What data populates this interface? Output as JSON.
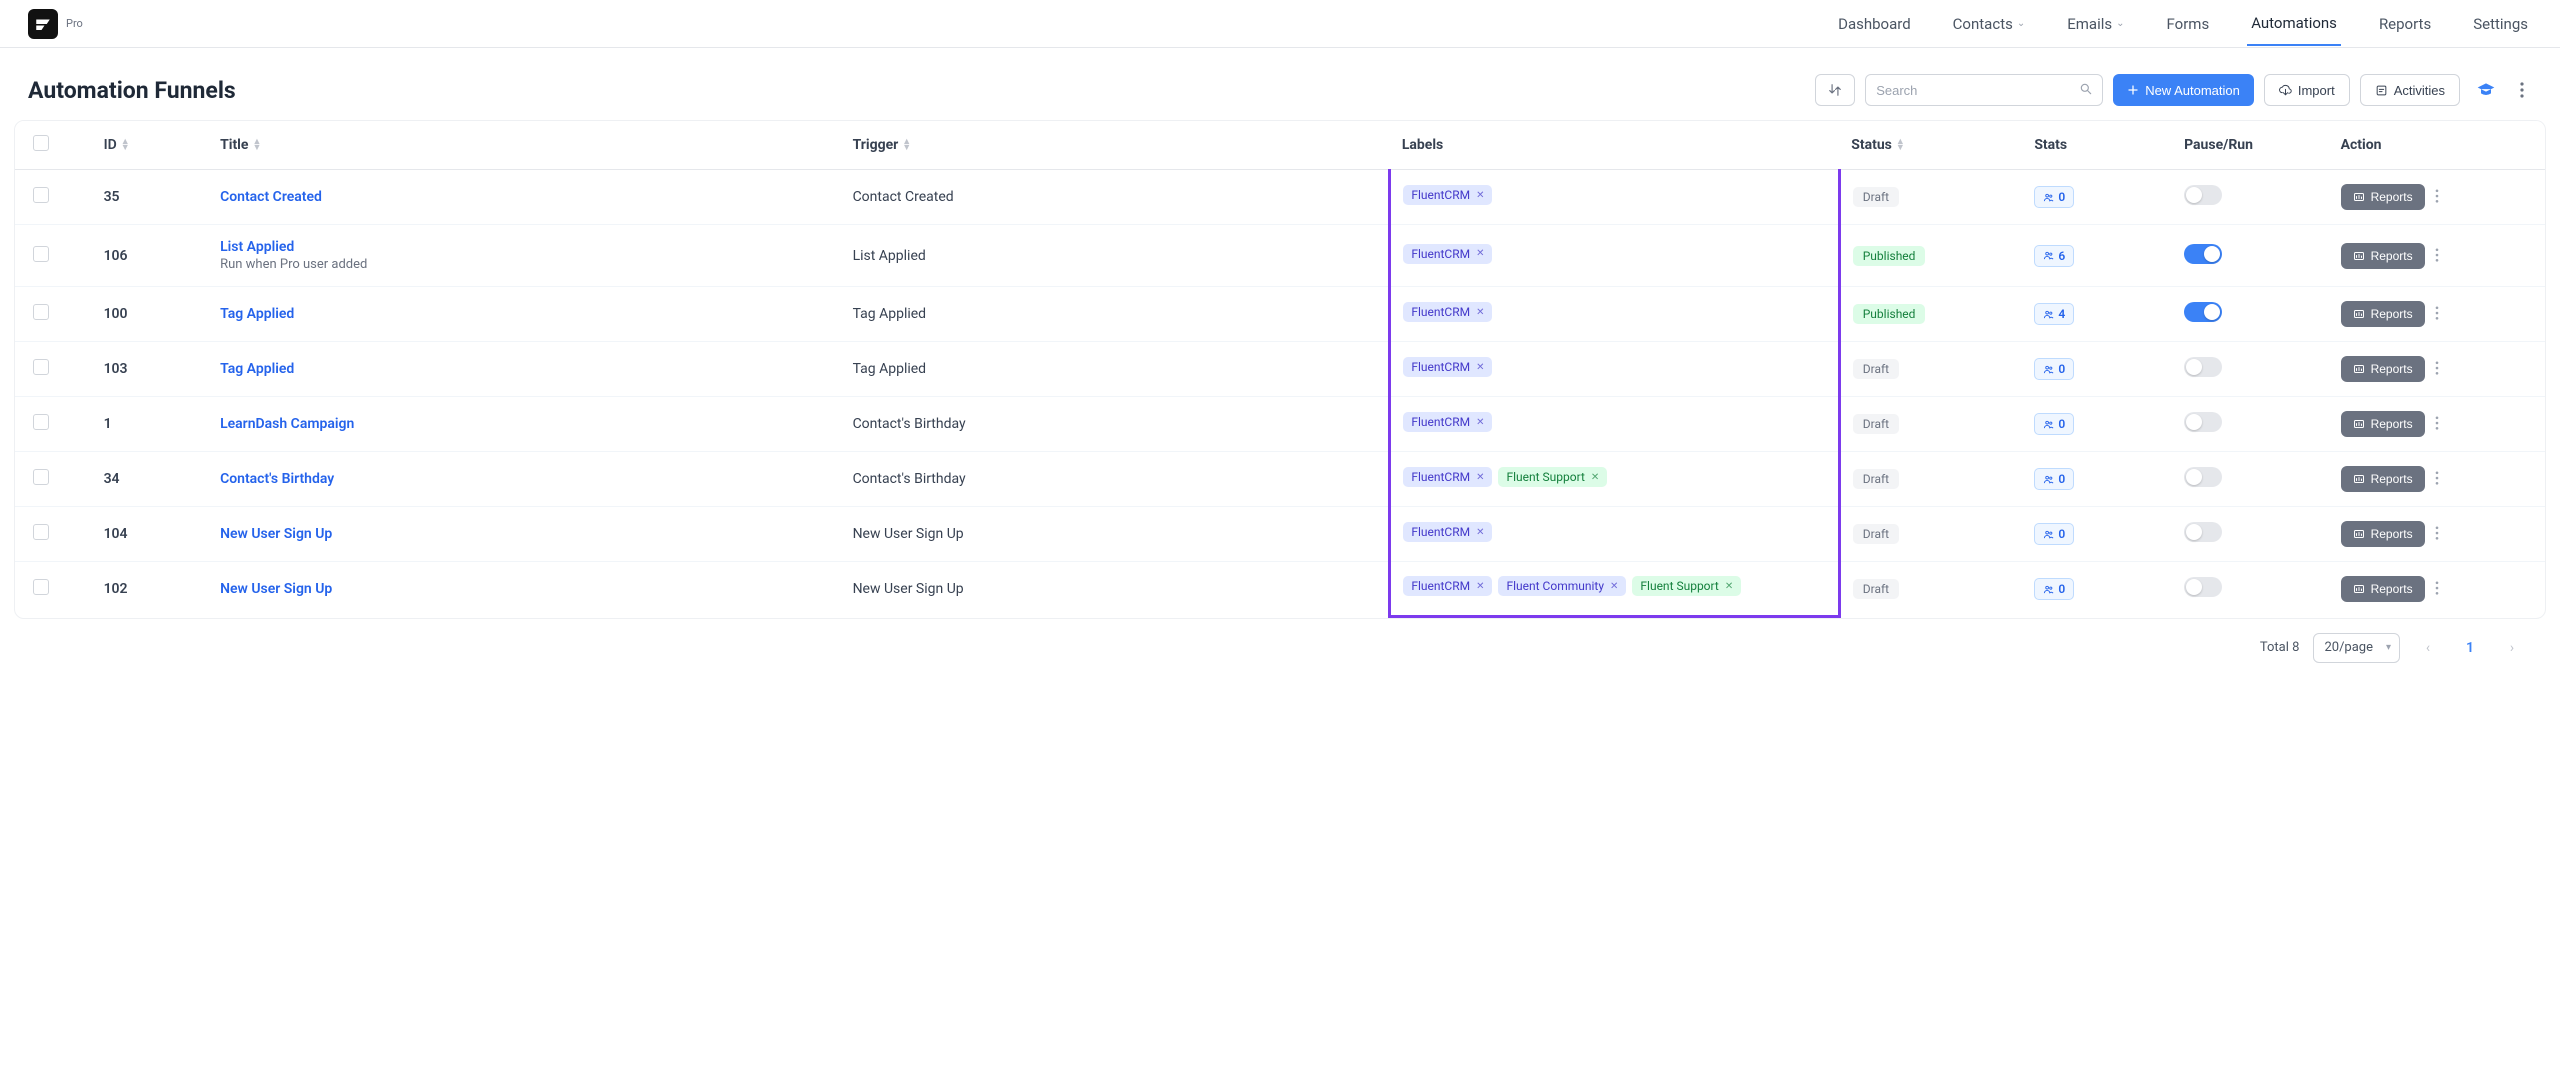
{
  "brand": {
    "name": "Pro"
  },
  "nav": {
    "items": [
      {
        "label": "Dashboard",
        "dropdown": false,
        "active": false
      },
      {
        "label": "Contacts",
        "dropdown": true,
        "active": false
      },
      {
        "label": "Emails",
        "dropdown": true,
        "active": false
      },
      {
        "label": "Forms",
        "dropdown": false,
        "active": false
      },
      {
        "label": "Automations",
        "dropdown": false,
        "active": true
      },
      {
        "label": "Reports",
        "dropdown": false,
        "active": false
      },
      {
        "label": "Settings",
        "dropdown": false,
        "active": false
      }
    ]
  },
  "page": {
    "title": "Automation Funnels"
  },
  "search": {
    "placeholder": "Search"
  },
  "buttons": {
    "new": "New Automation",
    "import": "Import",
    "activities": "Activities",
    "reports": "Reports"
  },
  "columns": {
    "id": "ID",
    "title": "Title",
    "trigger": "Trigger",
    "labels": "Labels",
    "status": "Status",
    "stats": "Stats",
    "pause": "Pause/Run",
    "action": "Action"
  },
  "status_labels": {
    "draft": "Draft",
    "published": "Published"
  },
  "label_names": {
    "fluentcrm": "FluentCRM",
    "fluentsupport": "Fluent Support",
    "fluentcommunity": "Fluent Community"
  },
  "rows": [
    {
      "id": "35",
      "title": "Contact Created",
      "subtitle": "",
      "trigger": "Contact Created",
      "labels": [
        "fluentcrm"
      ],
      "status": "draft",
      "stat": "0",
      "on": false
    },
    {
      "id": "106",
      "title": "List Applied",
      "subtitle": "Run when Pro user added",
      "trigger": "List Applied",
      "labels": [
        "fluentcrm"
      ],
      "status": "published",
      "stat": "6",
      "on": true
    },
    {
      "id": "100",
      "title": "Tag Applied",
      "subtitle": "",
      "trigger": "Tag Applied",
      "labels": [
        "fluentcrm"
      ],
      "status": "published",
      "stat": "4",
      "on": true
    },
    {
      "id": "103",
      "title": "Tag Applied",
      "subtitle": "",
      "trigger": "Tag Applied",
      "labels": [
        "fluentcrm"
      ],
      "status": "draft",
      "stat": "0",
      "on": false
    },
    {
      "id": "1",
      "title": "LearnDash Campaign",
      "subtitle": "",
      "trigger": "Contact's Birthday",
      "labels": [
        "fluentcrm"
      ],
      "status": "draft",
      "stat": "0",
      "on": false
    },
    {
      "id": "34",
      "title": "Contact's Birthday",
      "subtitle": "",
      "trigger": "Contact's Birthday",
      "labels": [
        "fluentcrm",
        "fluentsupport"
      ],
      "status": "draft",
      "stat": "0",
      "on": false
    },
    {
      "id": "104",
      "title": "New User Sign Up",
      "subtitle": "",
      "trigger": "New User Sign Up",
      "labels": [
        "fluentcrm"
      ],
      "status": "draft",
      "stat": "0",
      "on": false
    },
    {
      "id": "102",
      "title": "New User Sign Up",
      "subtitle": "",
      "trigger": "New User Sign Up",
      "labels": [
        "fluentcrm",
        "fluentcommunity",
        "fluentsupport"
      ],
      "status": "draft",
      "stat": "0",
      "on": false
    }
  ],
  "pagination": {
    "total_label": "Total 8",
    "page_size": "20/page",
    "current": "1"
  }
}
